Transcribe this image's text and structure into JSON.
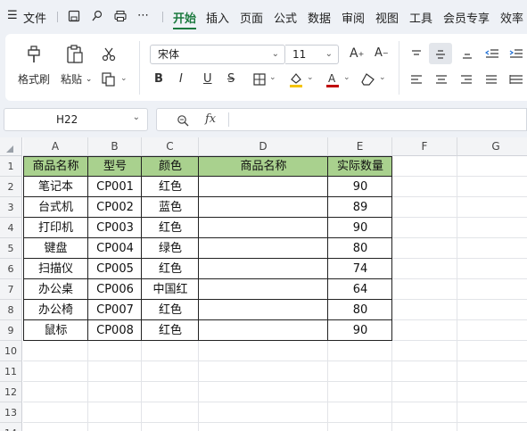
{
  "menu": {
    "hamburger": "☰",
    "file": "文件",
    "tabs": [
      "开始",
      "插入",
      "页面",
      "公式",
      "数据",
      "审阅",
      "视图",
      "工具",
      "会员专享",
      "效率"
    ],
    "active_tab": "开始"
  },
  "ribbon": {
    "format_painter": "格式刷",
    "paste": "粘贴",
    "font_name": "宋体",
    "font_size": "11"
  },
  "formula": {
    "name_box": "H22",
    "fx": "fx",
    "value": ""
  },
  "sheet": {
    "columns": [
      "A",
      "B",
      "C",
      "D",
      "E",
      "F",
      "G"
    ],
    "rows": [
      "1",
      "2",
      "3",
      "4",
      "5",
      "6",
      "7",
      "8",
      "9",
      "10",
      "11",
      "12",
      "13",
      "14"
    ],
    "header": [
      "商品名称",
      "型号",
      "颜色",
      "商品名称",
      "实际数量"
    ],
    "data": [
      [
        "笔记本",
        "CP001",
        "红色",
        "",
        "90"
      ],
      [
        "台式机",
        "CP002",
        "蓝色",
        "",
        "89"
      ],
      [
        "打印机",
        "CP003",
        "红色",
        "",
        "90"
      ],
      [
        "键盘",
        "CP004",
        "绿色",
        "",
        "80"
      ],
      [
        "扫描仪",
        "CP005",
        "红色",
        "",
        "74"
      ],
      [
        "办公桌",
        "CP006",
        "中国红",
        "",
        "64"
      ],
      [
        "办公椅",
        "CP007",
        "红色",
        "",
        "80"
      ],
      [
        "鼠标",
        "CP008",
        "红色",
        "",
        "90"
      ]
    ],
    "header_color": "#a9d18e"
  }
}
